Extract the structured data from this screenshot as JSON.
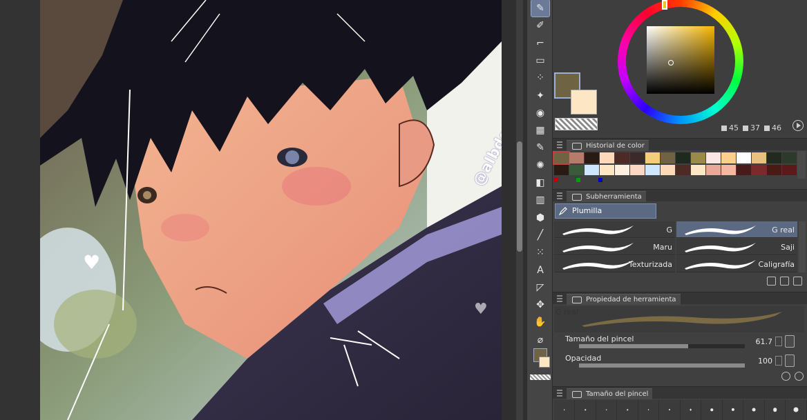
{
  "canvas": {
    "watermark": "@albdgreen"
  },
  "toolbar": {
    "tools": [
      {
        "name": "pen-tool-icon",
        "active": true
      },
      {
        "name": "eraser-purple-icon",
        "active": false
      },
      {
        "name": "dropper-icon",
        "active": false
      },
      {
        "name": "eraser-icon",
        "active": false
      },
      {
        "name": "spray-icon",
        "active": false
      },
      {
        "name": "sparkle-icon",
        "active": false
      },
      {
        "name": "blend-drops-icon",
        "active": false
      },
      {
        "name": "grid-icon",
        "active": false
      },
      {
        "name": "vector-pen-icon",
        "active": false
      },
      {
        "name": "burst-icon",
        "active": false
      },
      {
        "name": "fill-bucket-icon",
        "active": false
      },
      {
        "name": "gradient-icon",
        "active": false
      },
      {
        "name": "3d-cube-icon",
        "active": false
      },
      {
        "name": "line-icon",
        "active": false
      },
      {
        "name": "selection-icon",
        "active": false
      },
      {
        "name": "text-icon",
        "active": false
      },
      {
        "name": "ruler-icon",
        "active": false
      },
      {
        "name": "move-icon",
        "active": false
      },
      {
        "name": "hand-icon",
        "active": false
      },
      {
        "name": "eyedropper-icon",
        "active": false
      }
    ]
  },
  "color_panel": {
    "main_color": "#6e6443",
    "sub_color": "#fde6c4",
    "hsv": {
      "h": "45",
      "s": "37",
      "v": "46"
    }
  },
  "history": {
    "title": "Historial de color",
    "swatches_top": [
      "#6e6443",
      "#b77b6c",
      "#2a1a14",
      "#fcd9b9",
      "#4d2a24",
      "#3a2a2a",
      "#f5cc7a",
      "#6e6443",
      "#1e2a1e",
      "#9a8a4a",
      "#fde6e6",
      "#fcd08a",
      "#ffffff",
      "#e8c080",
      "#222a20",
      "#2c3a2c"
    ],
    "swatches_bottom": [
      "#2a1a14",
      "#3a5a3a",
      "#cfe6ff",
      "#fde6c4",
      "#fdf0e0",
      "#fbd7c4",
      "#cfe6ff",
      "#fcd9b9",
      "#4d2a24",
      "#fde6c4",
      "#e8a89a",
      "#f4b8a0",
      "#4a1a1a",
      "#7a2a2a",
      "#4a1a14",
      "#5a1a1a"
    ],
    "marks": [
      "#c00000",
      "#00a000",
      "#0000c0"
    ]
  },
  "subtool": {
    "title": "Subherramienta",
    "group": "Plumilla",
    "brushes": [
      {
        "name": "G",
        "selected": false
      },
      {
        "name": "G real",
        "selected": true
      },
      {
        "name": "Maru",
        "selected": false
      },
      {
        "name": "Saji",
        "selected": false
      },
      {
        "name": "Texturizada",
        "selected": false
      },
      {
        "name": "Caligrafía",
        "selected": false
      }
    ]
  },
  "tool_property": {
    "title": "Propiedad de herramienta",
    "preview_name": "G real",
    "brush_size_label": "Tamaño del pincel",
    "brush_size_value": "61.7",
    "brush_size_fraction": 0.66,
    "opacity_label": "Opacidad",
    "opacity_value": "100",
    "opacity_fraction": 1.0
  },
  "brush_size_panel": {
    "title": "Tamaño del pincel",
    "sizes": [
      0.7,
      1,
      1.5,
      2,
      2.5,
      3,
      4,
      5,
      6,
      7,
      8,
      10
    ]
  }
}
